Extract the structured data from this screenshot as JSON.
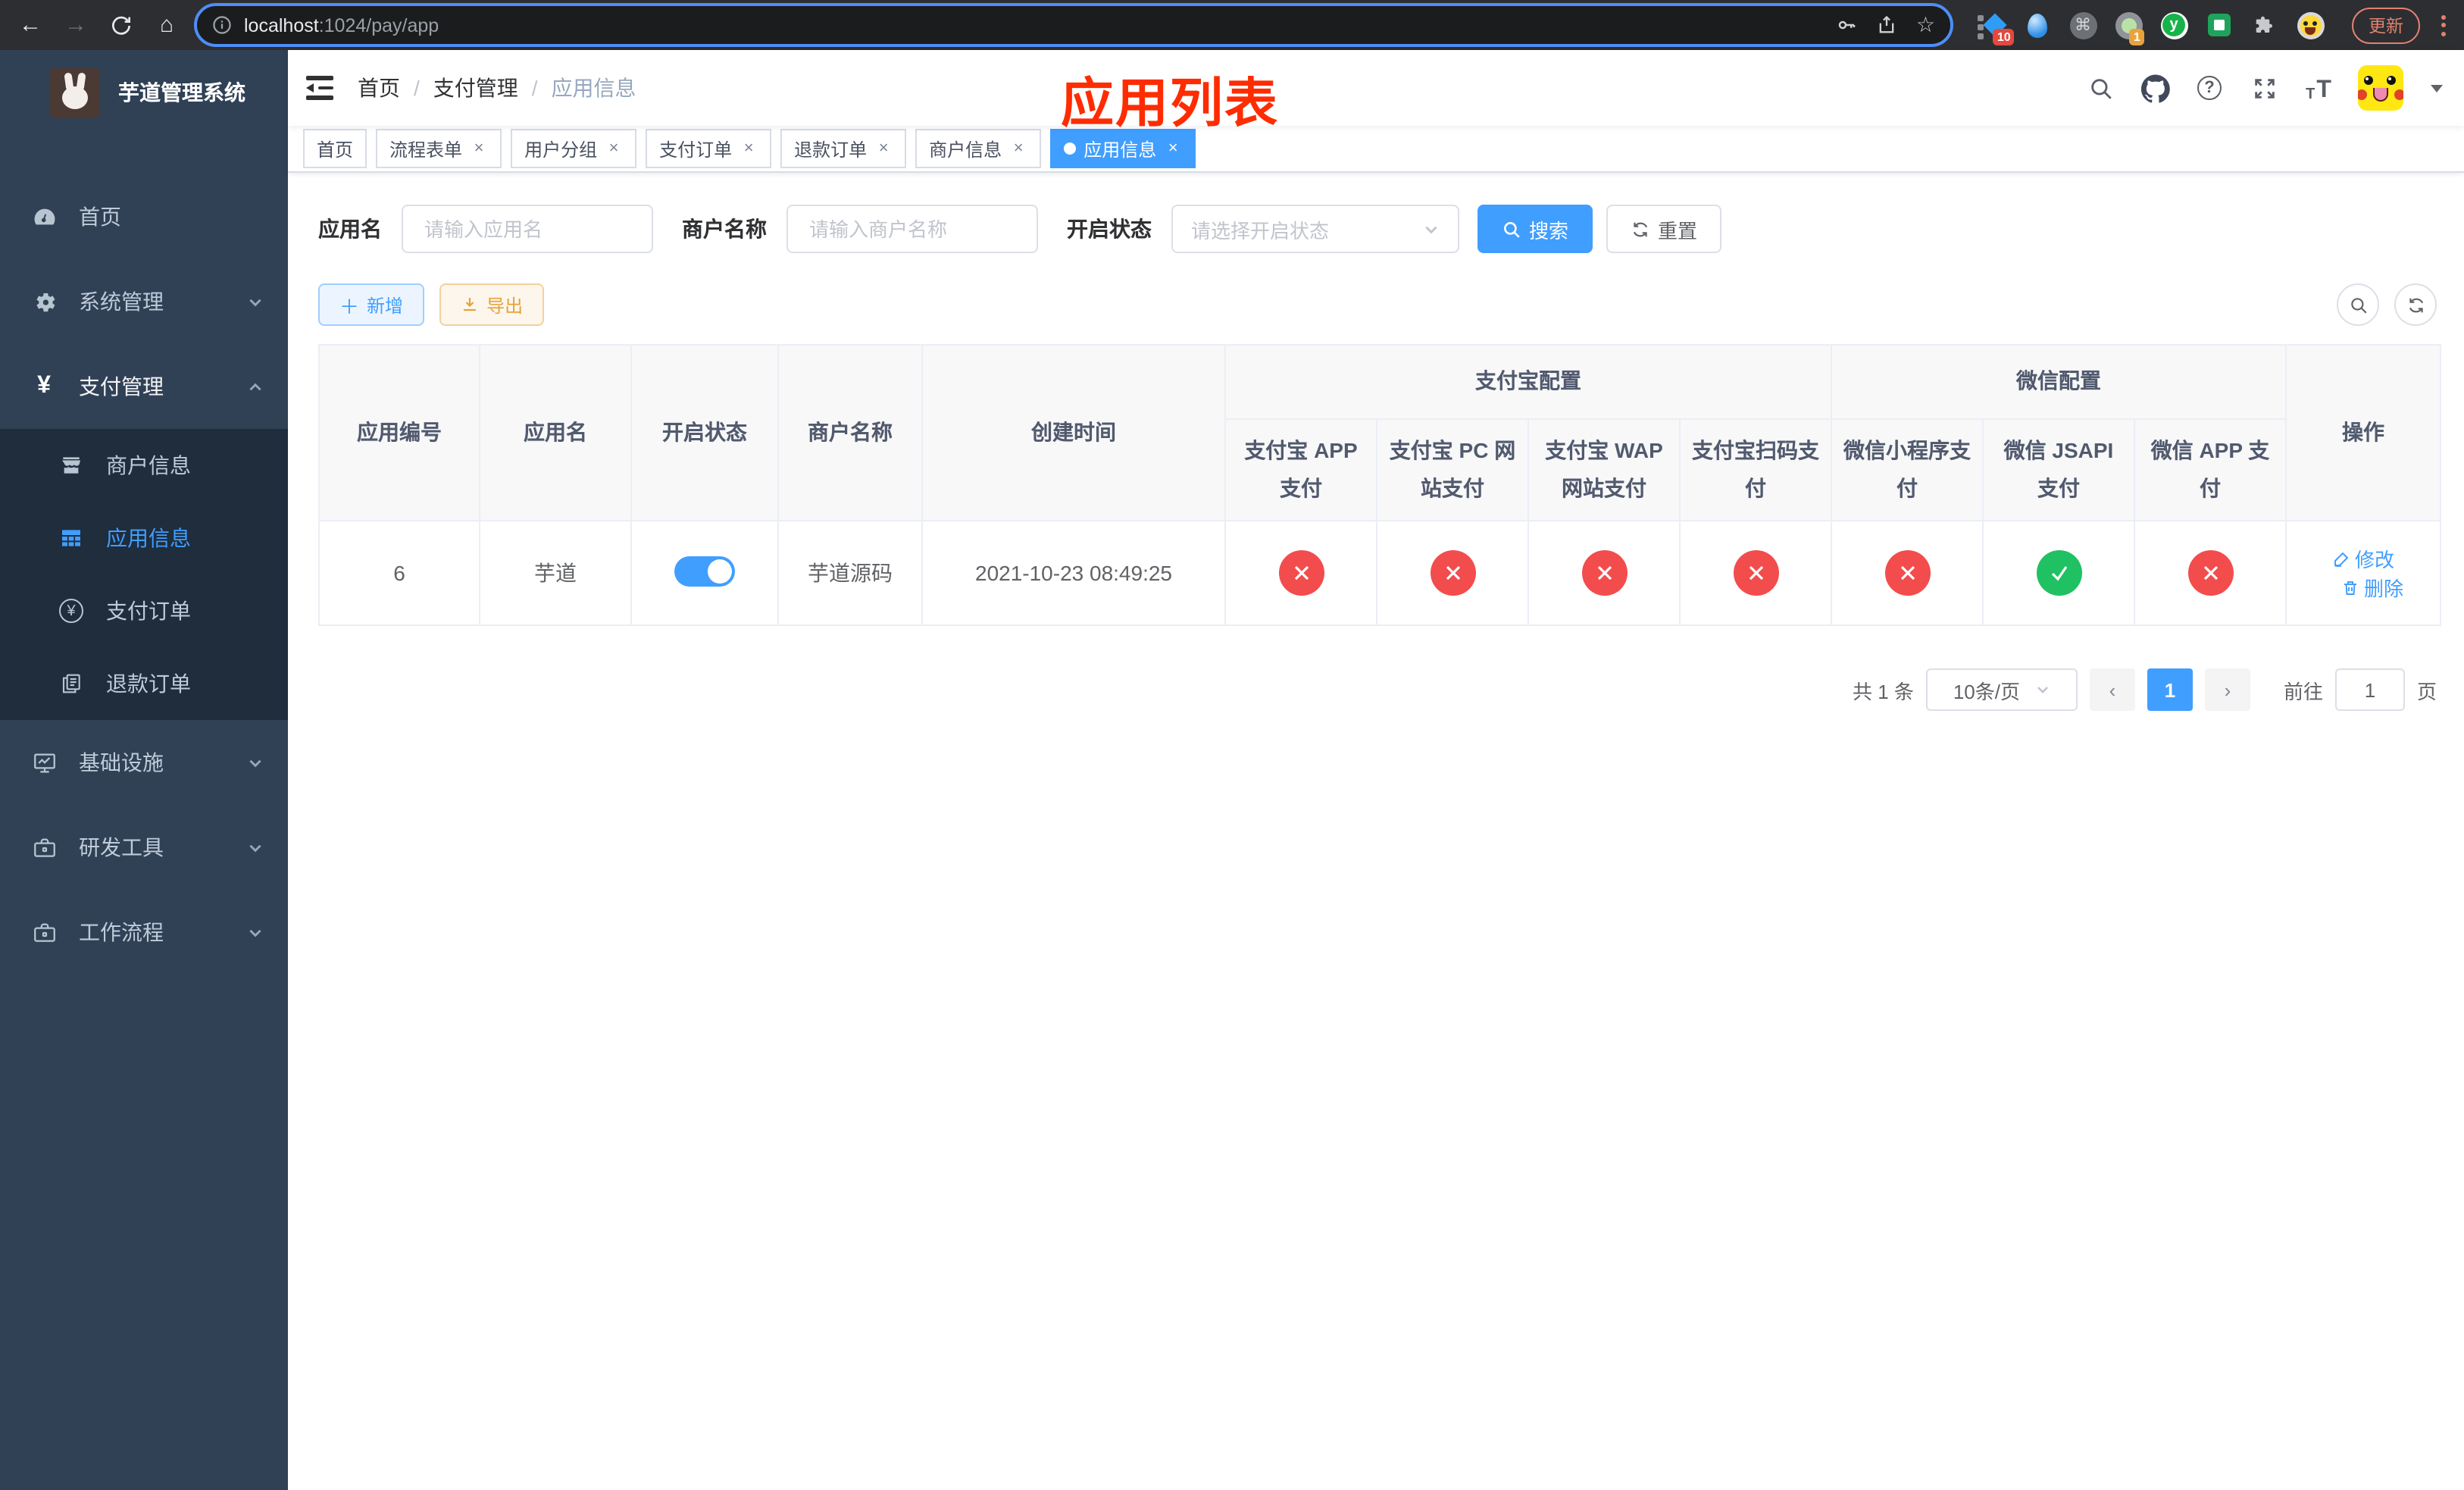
{
  "colors": {
    "primary": "#409eff",
    "success": "#1fc163",
    "danger": "#f34c4d",
    "warning": "#e6a23c",
    "annotation_red": "#fe2c00",
    "sidebar_bg": "#304156",
    "sidebar_submenu_bg": "#1f2d3d"
  },
  "browser": {
    "url_host": "localhost",
    "url_path": ":1024/pay/app",
    "ext_badge_blue": "10",
    "ext_badge_orange": "1",
    "ext_green_letter": "y",
    "update_label": "更新"
  },
  "sidebar": {
    "title": "芋道管理系统",
    "menu": [
      {
        "label": "首页"
      },
      {
        "label": "系统管理"
      },
      {
        "label": "支付管理"
      },
      {
        "label": "基础设施"
      },
      {
        "label": "研发工具"
      },
      {
        "label": "工作流程"
      }
    ],
    "submenu": [
      {
        "label": "商户信息"
      },
      {
        "label": "应用信息"
      },
      {
        "label": "支付订单"
      },
      {
        "label": "退款订单"
      }
    ]
  },
  "navbar": {
    "breadcrumb": [
      "首页",
      "支付管理",
      "应用信息"
    ],
    "separator": "/",
    "annotation": "应用列表"
  },
  "tabs": [
    {
      "label": "首页"
    },
    {
      "label": "流程表单"
    },
    {
      "label": "用户分组"
    },
    {
      "label": "支付订单"
    },
    {
      "label": "退款订单"
    },
    {
      "label": "商户信息"
    },
    {
      "label": "应用信息"
    }
  ],
  "filters": {
    "app_name_label": "应用名",
    "app_name_placeholder": "请输入应用名",
    "merchant_label": "商户名称",
    "merchant_placeholder": "请输入商户名称",
    "status_label": "开启状态",
    "status_placeholder": "请选择开启状态",
    "search_label": "搜索",
    "reset_label": "重置"
  },
  "toolbar": {
    "add_label": "新增",
    "export_label": "导出"
  },
  "table": {
    "headers": {
      "app_id": "应用编号",
      "app_name": "应用名",
      "status": "开启状态",
      "merchant": "商户名称",
      "created": "创建时间",
      "alipay_group": "支付宝配置",
      "wechat_group": "微信配置",
      "alipay_app": "支付宝 APP 支付",
      "alipay_pc": "支付宝 PC 网站支付",
      "alipay_wap": "支付宝 WAP 网站支付",
      "alipay_scan": "支付宝扫码支付",
      "wx_mini": "微信小程序支付",
      "wx_jsapi": "微信 JSAPI 支付",
      "wx_app": "微信 APP 支付",
      "actions": "操作"
    },
    "row": {
      "app_id": "6",
      "app_name": "芋道",
      "enabled": "on",
      "merchant": "芋道源码",
      "created": "2021-10-23 08:49:25",
      "statuses": [
        {
          "name": "支付宝 APP 支付",
          "state": "off"
        },
        {
          "name": "支付宝 PC 网站支付",
          "state": "off"
        },
        {
          "name": "支付宝 WAP 网站支付",
          "state": "off"
        },
        {
          "name": "支付宝扫码支付",
          "state": "off"
        },
        {
          "name": "微信小程序支付",
          "state": "off"
        },
        {
          "name": "微信 JSAPI 支付",
          "state": "on"
        },
        {
          "name": "微信 APP 支付",
          "state": "off"
        }
      ],
      "edit_label": "修改",
      "delete_label": "删除"
    }
  },
  "pagination": {
    "total": "共 1 条",
    "page_size": "10条/页",
    "prev": "‹",
    "page": "1",
    "next": "›",
    "goto_prefix": "前往",
    "goto_value": "1",
    "goto_suffix": "页"
  }
}
